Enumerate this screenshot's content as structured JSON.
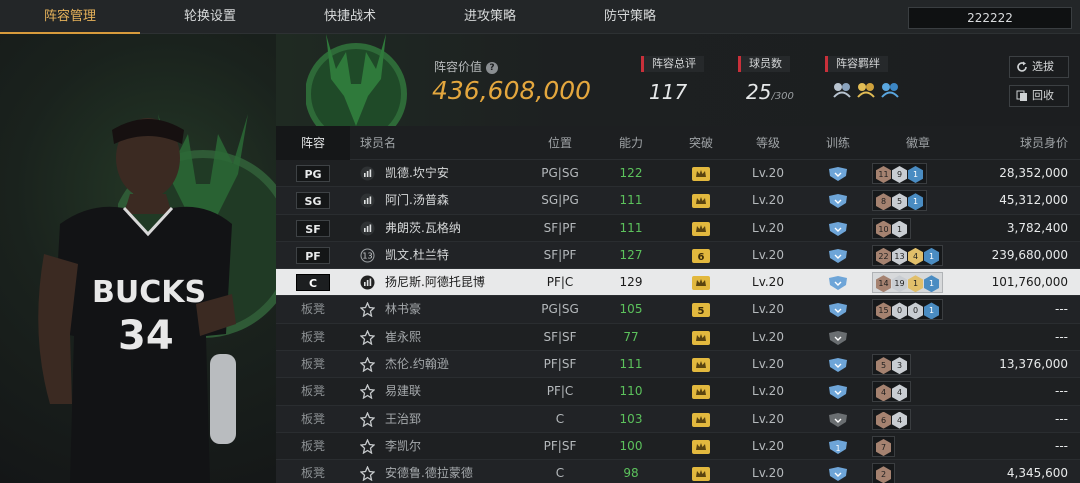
{
  "nav": {
    "tabs": [
      "阵容管理",
      "轮换设置",
      "快捷战术",
      "进攻策略",
      "防守策略"
    ],
    "active": 0,
    "search_value": "222222"
  },
  "summary": {
    "value_label": "阵容价值",
    "help_icon": "question-icon",
    "value": "436,608,000",
    "rating_label": "阵容总评",
    "rating": "117",
    "players_label": "球员数",
    "players": "25",
    "players_max": "/300",
    "bond_label": "阵容羁绊",
    "bond_icons": [
      "bond-icon-silver",
      "bond-icon-gold",
      "bond-icon-blue"
    ],
    "btn_select": "选拔",
    "btn_recall": "回收"
  },
  "table": {
    "headers": [
      "阵容",
      "球员名",
      "位置",
      "能力",
      "突破",
      "等级",
      "训练",
      "徽章",
      "球员身价"
    ],
    "rows": [
      {
        "slot": "PG",
        "bench": false,
        "name": "凯德.坎宁安",
        "pos": "PG|SG",
        "ability": "122",
        "breakthrough": "crown",
        "level": "Lv.20",
        "train": "shield-blue",
        "badges": [
          [
            "br",
            "11"
          ],
          [
            "si",
            "9"
          ],
          [
            "bl",
            "1"
          ]
        ],
        "value": "28,352,000"
      },
      {
        "slot": "SG",
        "bench": false,
        "name": "阿门.汤普森",
        "pos": "SG|PG",
        "ability": "111",
        "breakthrough": "crown",
        "level": "Lv.20",
        "train": "shield-blue",
        "badges": [
          [
            "br",
            "8"
          ],
          [
            "si",
            "5"
          ],
          [
            "bl",
            "1"
          ]
        ],
        "value": "45,312,000"
      },
      {
        "slot": "SF",
        "bench": false,
        "name": "弗朗茨.瓦格纳",
        "pos": "SF|PF",
        "ability": "111",
        "breakthrough": "crown",
        "level": "Lv.20",
        "train": "shield-blue",
        "badges": [
          [
            "br",
            "10"
          ],
          [
            "si",
            "1"
          ]
        ],
        "value": "3,782,400"
      },
      {
        "slot": "PF",
        "bench": false,
        "name": "凯文.杜兰特",
        "rank": "13",
        "pos": "SF|PF",
        "ability": "127",
        "breakthrough": "6",
        "level": "Lv.20",
        "train": "shield-blue",
        "badges": [
          [
            "br",
            "22"
          ],
          [
            "si",
            "13"
          ],
          [
            "go",
            "4"
          ],
          [
            "bl",
            "1"
          ]
        ],
        "value": "239,680,000"
      },
      {
        "slot": "C",
        "bench": false,
        "selected": true,
        "name": "扬尼斯.阿德托昆博",
        "pos": "PF|C",
        "ability": "129",
        "breakthrough": "crown",
        "level": "Lv.20",
        "train": "shield-blue",
        "badges": [
          [
            "br",
            "14"
          ],
          [
            "si",
            "19"
          ],
          [
            "go",
            "1"
          ],
          [
            "bl",
            "1"
          ]
        ],
        "value": "101,760,000"
      },
      {
        "slot": "板凳",
        "bench": true,
        "name": "林书豪",
        "pos": "PG|SG",
        "ability": "105",
        "breakthrough": "5",
        "level": "Lv.20",
        "train": "shield-blue",
        "badges": [
          [
            "br",
            "15"
          ],
          [
            "si",
            "0"
          ],
          [
            "si",
            "0"
          ],
          [
            "bl",
            "1"
          ]
        ],
        "value": "---"
      },
      {
        "slot": "板凳",
        "bench": true,
        "name": "崔永熙",
        "pos": "SF|SF",
        "ability": "77",
        "breakthrough": "crown",
        "level": "Lv.20",
        "train": "shield-grey",
        "badges": [],
        "value": "---"
      },
      {
        "slot": "板凳",
        "bench": true,
        "name": "杰伦.约翰逊",
        "pos": "PF|SF",
        "ability": "111",
        "breakthrough": "crown",
        "level": "Lv.20",
        "train": "shield-blue",
        "badges": [
          [
            "br",
            "5"
          ],
          [
            "si",
            "3"
          ]
        ],
        "value": "13,376,000"
      },
      {
        "slot": "板凳",
        "bench": true,
        "name": "易建联",
        "pos": "PF|C",
        "ability": "110",
        "breakthrough": "crown",
        "level": "Lv.20",
        "train": "shield-blue",
        "badges": [
          [
            "br",
            "4"
          ],
          [
            "si",
            "4"
          ]
        ],
        "value": "---"
      },
      {
        "slot": "板凳",
        "bench": true,
        "name": "王治郅",
        "pos": "C",
        "ability": "103",
        "breakthrough": "crown",
        "level": "Lv.20",
        "train": "shield-grey",
        "badges": [
          [
            "br",
            "6"
          ],
          [
            "si",
            "4"
          ]
        ],
        "value": "---"
      },
      {
        "slot": "板凳",
        "bench": true,
        "name": "李凯尔",
        "pos": "PF|SF",
        "ability": "100",
        "breakthrough": "crown",
        "level": "Lv.20",
        "train": "shield-blue-1",
        "badges": [
          [
            "br",
            "7"
          ]
        ],
        "value": "---"
      },
      {
        "slot": "板凳",
        "bench": true,
        "name": "安德鲁.德拉蒙德",
        "pos": "C",
        "ability": "98",
        "breakthrough": "crown",
        "level": "Lv.20",
        "train": "shield-blue",
        "badges": [
          [
            "br",
            "2"
          ]
        ],
        "value": "4,345,600"
      }
    ]
  },
  "colors": {
    "accent": "#e4a73e",
    "stat_marker": "#c9303a",
    "ability": "#5cc25c",
    "train_blue": "#6ea5d8"
  }
}
